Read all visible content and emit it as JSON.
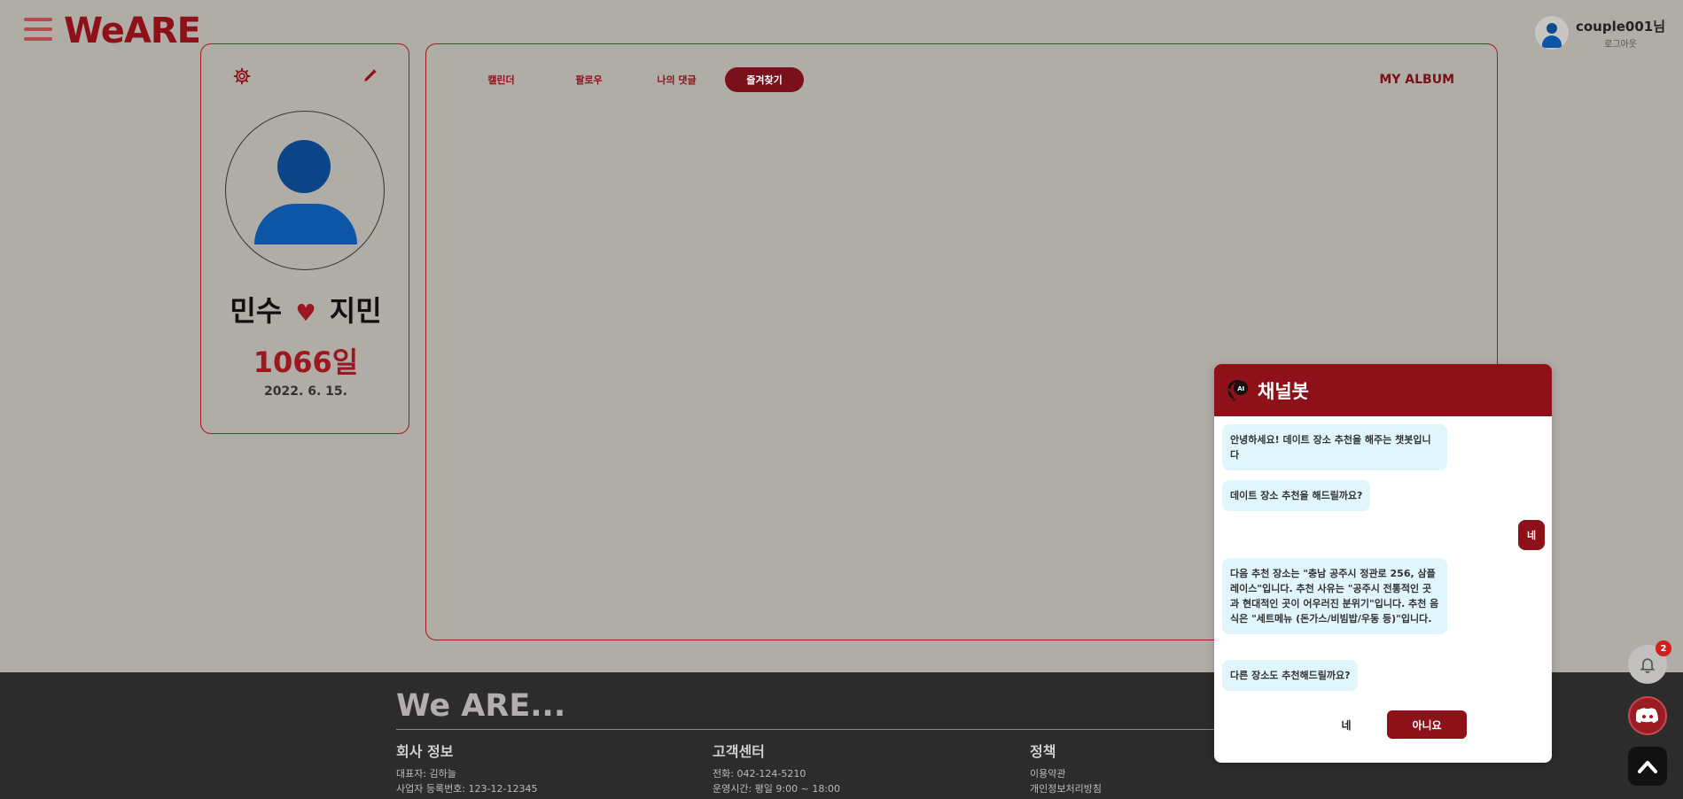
{
  "header": {
    "logo": "WeARE",
    "user_name": "couple001님",
    "logout": "로그아웃"
  },
  "profile": {
    "name_left": "민수",
    "heart": "♥",
    "name_right": "지민",
    "day_count": "1066일",
    "start_date": "2022. 6. 15."
  },
  "main": {
    "tabs": [
      {
        "label": "캘린더",
        "active": false
      },
      {
        "label": "팔로우",
        "active": false
      },
      {
        "label": "나의 댓글",
        "active": false
      },
      {
        "label": "즐겨찾기",
        "active": true
      }
    ],
    "album_link": "MY ALBUM"
  },
  "footer": {
    "brand": "We ARE...",
    "company": {
      "title": "회사 정보",
      "lines": [
        "대표자: 김하늘",
        "사업자 등록번호: 123-12-12345"
      ]
    },
    "support": {
      "title": "고객센터",
      "lines": [
        "전화: 042-124-5210",
        "운영시간: 평일 9:00 ~ 18:00"
      ]
    },
    "policy": {
      "title": "정책",
      "lines": [
        "이용약관",
        "개인정보처리방침"
      ]
    }
  },
  "chatbot": {
    "title": "채널봇",
    "messages": [
      {
        "from": "bot",
        "text": "안녕하세요! 데이트 장소 추천을 해주는 챗봇입니다"
      },
      {
        "from": "bot",
        "text": "데이트 장소 추천을 해드릴까요?"
      },
      {
        "from": "user",
        "text": "네"
      },
      {
        "from": "bot",
        "text": "다음 추천 장소는 \"충남 공주시 정관로 256, 삼플레이스\"입니다. 추천 사유는 \"공주시 전통적인 곳과 현대적인 곳이 어우러진 분위기\"입니다. 추천 음식은 \"세트메뉴 (돈가스/비빔밥/우동 등)\"입니다."
      },
      {
        "from": "bot",
        "text": "다른 장소도 추천해드릴까요?"
      }
    ],
    "yes_label": "네",
    "no_label": "아니요"
  },
  "notifications": {
    "count": "2"
  },
  "colors": {
    "brand": "#8e1018",
    "bot_bubble": "#e1f5fd"
  }
}
